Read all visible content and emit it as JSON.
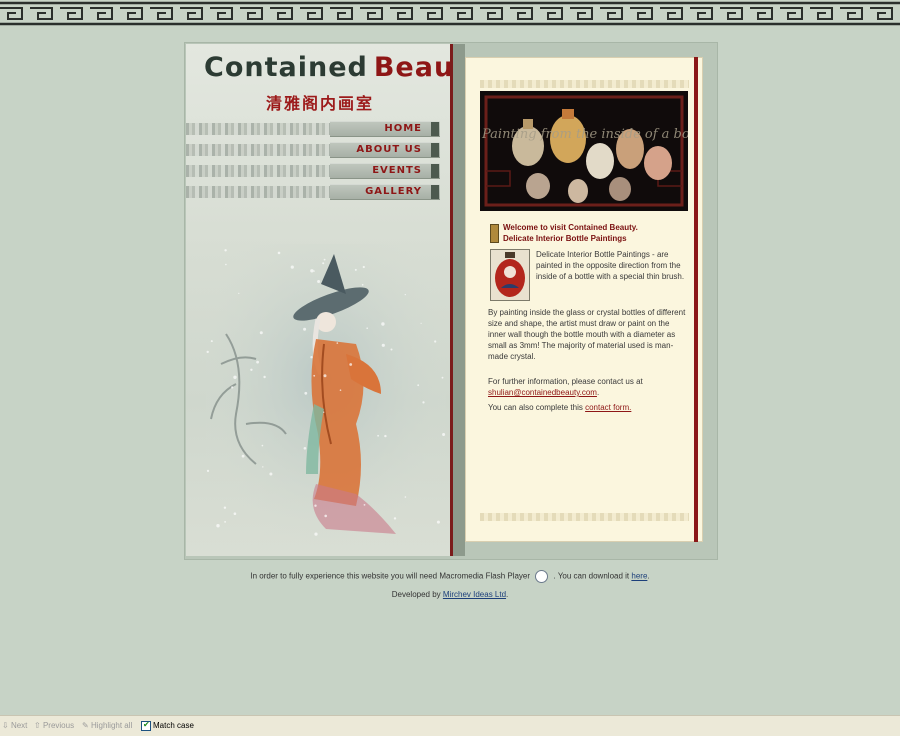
{
  "logo": {
    "title_part1": "Contained",
    "title_part2": "Beauty",
    "chinese": "清雅阁内画室"
  },
  "nav": {
    "items": [
      {
        "label": "HOME"
      },
      {
        "label": "ABOUT US"
      },
      {
        "label": "EVENTS"
      },
      {
        "label": "GALLERY"
      }
    ]
  },
  "content": {
    "photo_caption": "Painting from the inside of a bottle",
    "welcome_line1": "Welcome to visit Contained Beauty.",
    "welcome_line2": "Delicate Interior Bottle Paintings",
    "para1": "Delicate Interior Bottle Paintings - are painted in the opposite direction from the inside of a bottle with a special thin brush.",
    "para2": "By painting inside the glass or crystal bottles of different size and shape, the artist must draw or paint on the inner wall though the bottle mouth with a diameter as small as 3mm! The majority of material used is man-made crystal.",
    "para3_text": "For further information, please contact us at",
    "email": "shulian@containedbeauty.com",
    "para3_end": ".",
    "para4_text": "You can also complete this",
    "contact_form": "contact form."
  },
  "footer": {
    "flash_text": "In order to fully experience this website you will need Macromedia Flash Player",
    "download_text": ". You can download it",
    "here": "here",
    "dot": ".",
    "developed_by": "Developed by",
    "developer": "Mirchev Ideas Ltd",
    "dev_dot": "."
  },
  "findbar": {
    "next": "Next",
    "previous": "Previous",
    "highlight": "Highlight all",
    "match_case": "Match case",
    "match_case_checked": true
  },
  "colors": {
    "brand_red": "#8e1616",
    "background": "#c7d3c6",
    "content_bg": "#fbf6de"
  }
}
